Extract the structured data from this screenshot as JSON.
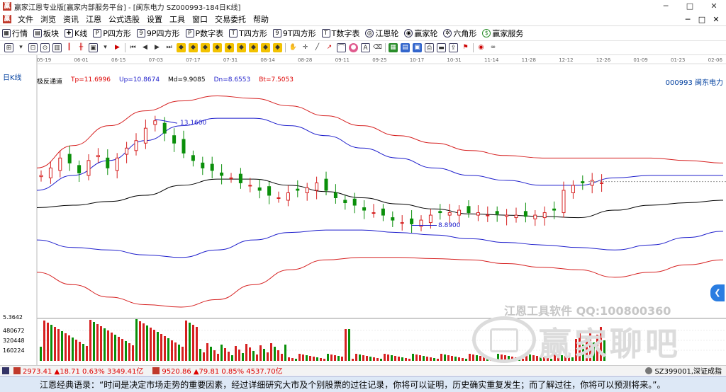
{
  "window": {
    "title": "赢家江恩专业版[赢家内部服务平台] - [闽东电力  SZ000993-184日K线]",
    "app_icon": "赢",
    "minimize": "─",
    "maximize": "□",
    "close": "✕"
  },
  "menu": {
    "items": [
      "文件",
      "浏览",
      "资讯",
      "江恩",
      "公式选股",
      "设置",
      "工具",
      "窗口",
      "交易委托",
      "帮助"
    ],
    "right_controls": [
      "─",
      "□",
      "✕"
    ]
  },
  "toolbar1": {
    "buttons": [
      {
        "label": "行情",
        "icon": "grid-icon"
      },
      {
        "label": "板块",
        "icon": "board-icon"
      },
      {
        "label": "K线",
        "icon": "kline-icon"
      },
      {
        "label": "P四方形",
        "icon": "square-p-icon"
      },
      {
        "label": "9P四方形",
        "icon": "square-9p-icon"
      },
      {
        "label": "P数字表",
        "icon": "pnum-table-icon"
      },
      {
        "label": "T四方形",
        "icon": "square-t-icon"
      },
      {
        "label": "9T四方形",
        "icon": "square-9t-icon"
      },
      {
        "label": "T数字表",
        "icon": "tnum-table-icon"
      },
      {
        "label": "江恩轮",
        "icon": "gann-wheel-icon"
      },
      {
        "label": "赢家轮",
        "icon": "winner-wheel-icon"
      },
      {
        "label": "六角形",
        "icon": "hexagon-icon"
      },
      {
        "label": "赢家服务",
        "icon": "service-icon"
      }
    ]
  },
  "chart": {
    "period_label": "日K线",
    "indicator_name": "极反通道",
    "tp": "Tp=11.6996",
    "up": "Up=10.8674",
    "md": "Md=9.9085",
    "dn": "Dn=8.6553",
    "bt": "Bt=7.5053",
    "stock_id": "000993  闽东电力",
    "high_label": "13.1600",
    "low_label": "8.8900",
    "colors": {
      "upper_band": "#d62020",
      "mid_band": "#1f1fcc",
      "center_line": "#000000",
      "candle_up": "#d62020",
      "candle_down": "#0a8f0a"
    }
  },
  "chart_data": {
    "type": "line",
    "x_tick_labels": [
      "05-19",
      "06-01",
      "06-15",
      "07-03",
      "07-17",
      "07-31",
      "08-14",
      "08-28",
      "09-11",
      "09-25",
      "10-17",
      "10-31",
      "11-14",
      "11-28",
      "12-12",
      "12-26",
      "01-09",
      "01-23",
      "02-06"
    ],
    "volume_axis_labels": [
      "5.3642",
      "480672",
      "320448",
      "160224"
    ],
    "annotations": [
      "13.1600",
      "8.8900"
    ],
    "series": [
      {
        "name": "Tp",
        "values": [
          11.2,
          12.1,
          12.9,
          13.5,
          13.9,
          14.1,
          14.0,
          13.7,
          13.3,
          12.9,
          12.5,
          12.2,
          11.9,
          11.7,
          11.6,
          11.6,
          11.6,
          11.6,
          11.5,
          11.4
        ]
      },
      {
        "name": "Up",
        "values": [
          10.3,
          10.9,
          11.5,
          12.3,
          12.9,
          13.2,
          13.2,
          12.9,
          12.5,
          12.0,
          11.6,
          11.2,
          10.9,
          10.7,
          10.5,
          10.5,
          10.8,
          10.9,
          10.9,
          10.9
        ]
      },
      {
        "name": "Md",
        "values": [
          9.6,
          9.7,
          9.85,
          10.1,
          10.5,
          10.75,
          10.75,
          10.5,
          10.25,
          10.0,
          9.75,
          9.55,
          9.35,
          9.3,
          9.25,
          9.2,
          9.5,
          9.7,
          9.8,
          9.9
        ]
      },
      {
        "name": "Dn",
        "values": [
          8.3,
          8.0,
          7.9,
          7.7,
          7.6,
          7.9,
          8.3,
          8.6,
          8.7,
          8.7,
          8.6,
          8.5,
          8.35,
          8.2,
          8.1,
          8.0,
          7.9,
          8.1,
          8.4,
          8.65
        ]
      },
      {
        "name": "Bt",
        "values": [
          7.0,
          6.5,
          6.0,
          5.7,
          5.6,
          5.9,
          6.5,
          7.1,
          7.5,
          7.6,
          7.6,
          7.55,
          7.5,
          7.35,
          7.2,
          7.1,
          6.8,
          7.0,
          7.3,
          7.5
        ]
      }
    ],
    "close_prices": [
      10.9,
      11.2,
      11.6,
      11.4,
      11.0,
      11.5,
      11.7,
      11.2,
      11.6,
      12.0,
      12.3,
      12.8,
      13.1,
      12.6,
      12.2,
      11.8,
      11.5,
      11.2,
      11.1,
      10.9,
      10.8,
      10.6,
      10.5,
      10.3,
      10.1,
      10.0,
      10.2,
      10.3,
      10.4,
      10.6,
      10.3,
      10.0,
      9.8,
      9.7,
      9.5,
      9.4,
      9.3,
      9.1,
      9.0,
      8.95,
      9.1,
      9.3,
      9.4,
      9.4,
      9.5,
      9.4,
      9.4,
      9.3,
      9.35,
      9.3,
      9.3,
      9.25,
      9.3,
      9.4,
      9.5,
      10.3,
      10.5,
      10.6,
      10.7,
      10.6
    ]
  }
}
